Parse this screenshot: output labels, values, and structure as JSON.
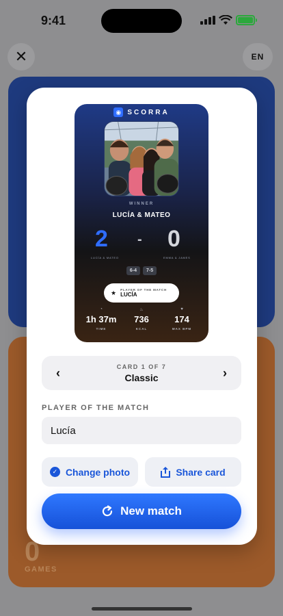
{
  "status": {
    "time": "9:41"
  },
  "top": {
    "close_icon": "close-icon",
    "lang": "EN"
  },
  "background": {
    "bottom_value": "0",
    "bottom_label": "GAMES"
  },
  "preview": {
    "brand": "SCORRA",
    "winner_label": "WINNER",
    "winner_name": "LUCÍA & MATEO",
    "score_a": "2",
    "score_sep": "-",
    "score_b": "0",
    "team_a": "LUCÍA & MATEO",
    "team_b": "EMMA & JAMES",
    "sets": [
      "6-4",
      "7-5"
    ],
    "potm_label": "PLAYER OF THE MATCH",
    "potm_name": "LUCÍA",
    "stats": [
      {
        "icon": "stopwatch-icon",
        "value": "1h 37m",
        "label": "TIME"
      },
      {
        "icon": "flame-icon",
        "value": "736",
        "label": "KCAL"
      },
      {
        "icon": "heart-icon",
        "value": "174",
        "label": "MAX BPM"
      }
    ]
  },
  "selector": {
    "counter": "CARD 1 OF 7",
    "name": "Classic"
  },
  "potm_field": {
    "label": "PLAYER OF THE MATCH",
    "value": "Lucía"
  },
  "actions": {
    "change_photo": "Change photo",
    "share_card": "Share card"
  },
  "primary": {
    "label": "New match"
  },
  "colors": {
    "accent": "#1a56d9",
    "blue_card": "#1e3a7e",
    "orange_card": "#9c5a2a"
  }
}
